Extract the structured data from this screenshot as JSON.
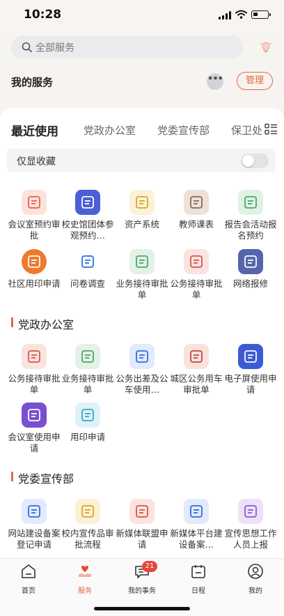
{
  "status": {
    "time": "10:28"
  },
  "search": {
    "placeholder": "全部服务"
  },
  "my_services": {
    "title": "我的服务",
    "more": "•••",
    "manage": "管理"
  },
  "tabs": [
    "最近使用",
    "党政办公室",
    "党委宣传部",
    "保卫处"
  ],
  "favorites_only": {
    "label": "仅显收藏",
    "on": false
  },
  "recent": [
    {
      "label": "会议室预约审批",
      "icon": "meeting-room-icon",
      "color": "#e8604a",
      "bg": "#fbe3dc"
    },
    {
      "label": "校史馆团体参观预约…",
      "icon": "museum-visit-icon",
      "color": "#4b5fd6",
      "bg": "#4b5fd6"
    },
    {
      "label": "资产系统",
      "icon": "wallet-icon",
      "color": "#d8a623",
      "bg": "#fbf2d8"
    },
    {
      "label": "教师课表",
      "icon": "timetable-icon",
      "color": "#8a6a55",
      "bg": "#ece2da"
    },
    {
      "label": "报告会活动报名预约",
      "icon": "report-meeting-icon",
      "color": "#4aa86a",
      "bg": "#e1f2e5"
    },
    {
      "label": "社区用印申请",
      "icon": "user-seal-icon",
      "color": "#ee7a2e",
      "bg": "#fff"
    },
    {
      "label": "问卷调查",
      "icon": "survey-icon",
      "color": "#2f6fe0",
      "bg": "#fff"
    },
    {
      "label": "业务接待审批单",
      "icon": "reception-icon",
      "color": "#4aa86a",
      "bg": "#e3f1e6"
    },
    {
      "label": "公务接待审批单",
      "icon": "calendar-approval-icon",
      "color": "#d9534a",
      "bg": "#fbe3df"
    },
    {
      "label": "网络报修",
      "icon": "repair-tools-icon",
      "color": "#5566aa",
      "bg": "#5566aa"
    }
  ],
  "sections": [
    {
      "title": "党政办公室",
      "items": [
        {
          "label": "公务接待审批单",
          "icon": "calendar-approval-icon",
          "color": "#d9534a",
          "bg": "#fbe3df"
        },
        {
          "label": "业务接待审批单",
          "icon": "reception-icon",
          "color": "#4aa86a",
          "bg": "#e3f1e6"
        },
        {
          "label": "公务出差及公车使用…",
          "icon": "business-trip-icon",
          "color": "#2f6fe0",
          "bg": "#e2eafb"
        },
        {
          "label": "城区公务用车审批单",
          "icon": "vehicle-approval-icon",
          "color": "#c9463c",
          "bg": "#f9e1de"
        },
        {
          "label": "电子屏使用申请",
          "icon": "screen-icon",
          "color": "#3b5bd6",
          "bg": "#3b5bd6"
        },
        {
          "label": "会议室使用申请",
          "icon": "room-use-icon",
          "color": "#7a4fd0",
          "bg": "#7a4fd0"
        },
        {
          "label": "用印申请",
          "icon": "seal-apply-icon",
          "color": "#2fa9c9",
          "bg": "#dff2f7"
        }
      ]
    },
    {
      "title": "党委宣传部",
      "items": [
        {
          "label": "网站建设备案登记申请",
          "icon": "website-filing-icon",
          "color": "#2f6fe0",
          "bg": "#e2eafb"
        },
        {
          "label": "校内宣传品审批流程",
          "icon": "billboard-icon",
          "color": "#d8a623",
          "bg": "#fbf1d6"
        },
        {
          "label": "新媒体联盟申请",
          "icon": "new-media-icon",
          "color": "#d9534a",
          "bg": "#fbe3df"
        },
        {
          "label": "新媒体平台建设备案…",
          "icon": "media-platform-icon",
          "color": "#2f6fe0",
          "bg": "#e2eafb"
        },
        {
          "label": "宣传思想工作人员上报",
          "icon": "staff-report-icon",
          "color": "#8a5ad6",
          "bg": "#ece2f8"
        }
      ]
    }
  ],
  "tabbar": [
    {
      "label": "首页",
      "icon": "home-icon"
    },
    {
      "label": "服务",
      "icon": "heart-hand-icon",
      "active": true
    },
    {
      "label": "我的事务",
      "icon": "message-icon",
      "badge": "21"
    },
    {
      "label": "日程",
      "icon": "calendar-icon"
    },
    {
      "label": "我的",
      "icon": "profile-icon"
    }
  ],
  "accent": "#e06a3a"
}
